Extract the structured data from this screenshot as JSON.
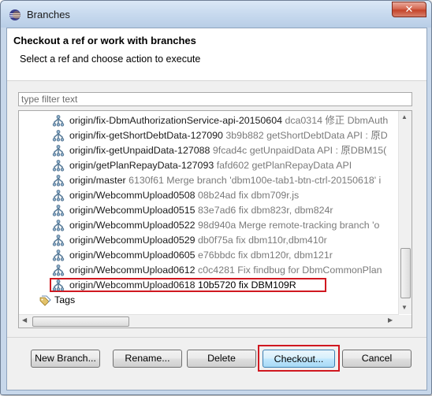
{
  "window": {
    "title": "Branches",
    "close_glyph": "✕"
  },
  "header": {
    "title": "Checkout a ref or work with branches",
    "subtitle": "Select a ref and choose action to execute"
  },
  "filter": {
    "placeholder": "type filter text",
    "value": ""
  },
  "tree": {
    "rows": [
      {
        "ref": "origin/fix-DbmAuthorizationService-api-20150604",
        "desc": "dca0314 修正 DbmAuth",
        "icon": "branch-icon"
      },
      {
        "ref": "origin/fix-getShortDebtData-127090",
        "desc": "3b9b882 getShortDebtData API : 原D",
        "icon": "branch-icon"
      },
      {
        "ref": "origin/fix-getUnpaidData-127088",
        "desc": "9fcad4c getUnpaidData API : 原DBM15(",
        "icon": "branch-icon"
      },
      {
        "ref": "origin/getPlanRepayData-127093",
        "desc": "fafd602 getPlanRepayData API",
        "icon": "branch-icon"
      },
      {
        "ref": "origin/master",
        "desc": "6130f61 Merge branch 'dbm100e-tab1-btn-ctrl-20150618' i",
        "icon": "branch-icon"
      },
      {
        "ref": "origin/WebcommUpload0508",
        "desc": "08b24ad fix dbm709r.js",
        "icon": "branch-icon"
      },
      {
        "ref": "origin/WebcommUpload0515",
        "desc": "83e7ad6 fix dbm823r, dbm824r",
        "icon": "branch-icon"
      },
      {
        "ref": "origin/WebcommUpload0522",
        "desc": "98d940a Merge remote-tracking branch 'o",
        "icon": "branch-icon"
      },
      {
        "ref": "origin/WebcommUpload0529",
        "desc": "db0f75a fix dbm110r,dbm410r",
        "icon": "branch-icon"
      },
      {
        "ref": "origin/WebcommUpload0605",
        "desc": "e76bbdc fix dbm120r, dbm121r",
        "icon": "branch-icon"
      },
      {
        "ref": "origin/WebcommUpload0612",
        "desc": "c0c4281 Fix findbug for DbmCommonPlan",
        "icon": "branch-icon"
      }
    ],
    "selected_row": {
      "ref": "origin/WebcommUpload0618",
      "desc": "10b5720 fix DBM109R",
      "icon": "branch-icon"
    },
    "tags_node": {
      "label": "Tags",
      "icon": "tags-icon"
    }
  },
  "buttons": {
    "new_branch": "New Branch...",
    "rename": "Rename...",
    "delete": "Delete",
    "checkout": "Checkout...",
    "cancel": "Cancel"
  },
  "colors": {
    "highlight_border": "#d01820",
    "dialog_background": "#f0f0f0",
    "frame": "#c7d7ea"
  }
}
